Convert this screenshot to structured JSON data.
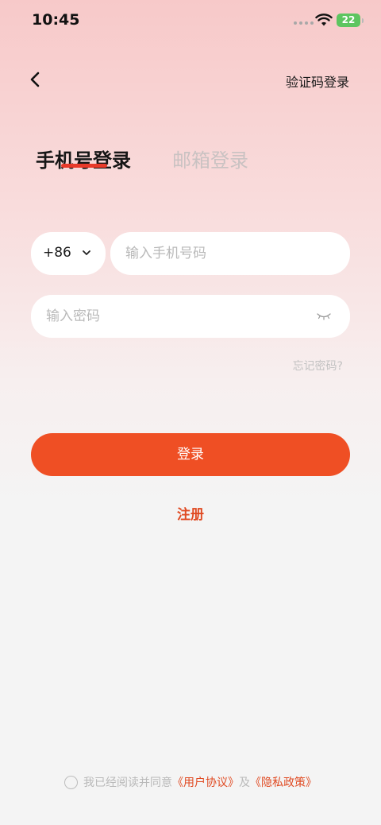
{
  "status_bar": {
    "time": "10:45",
    "battery": "22"
  },
  "header": {
    "sms_login_label": "验证码登录"
  },
  "tabs": [
    {
      "label": "手机号登录",
      "active": true
    },
    {
      "label": "邮箱登录",
      "active": false
    }
  ],
  "form": {
    "country_code": "+86",
    "phone_placeholder": "输入手机号码",
    "password_placeholder": "输入密码",
    "forgot_label": "忘记密码?"
  },
  "actions": {
    "login_label": "登录",
    "register_label": "注册"
  },
  "agreement": {
    "prefix": "我已经阅读并同意",
    "user_agreement": "《用户协议》",
    "conjunction": "及",
    "privacy_policy": "《隐私政策》"
  },
  "colors": {
    "accent": "#ef4f24",
    "link": "#e04a22",
    "battery": "#5dc560"
  },
  "icons": [
    "back-icon",
    "chevron-down-icon",
    "eye-closed-icon",
    "wifi-icon"
  ]
}
